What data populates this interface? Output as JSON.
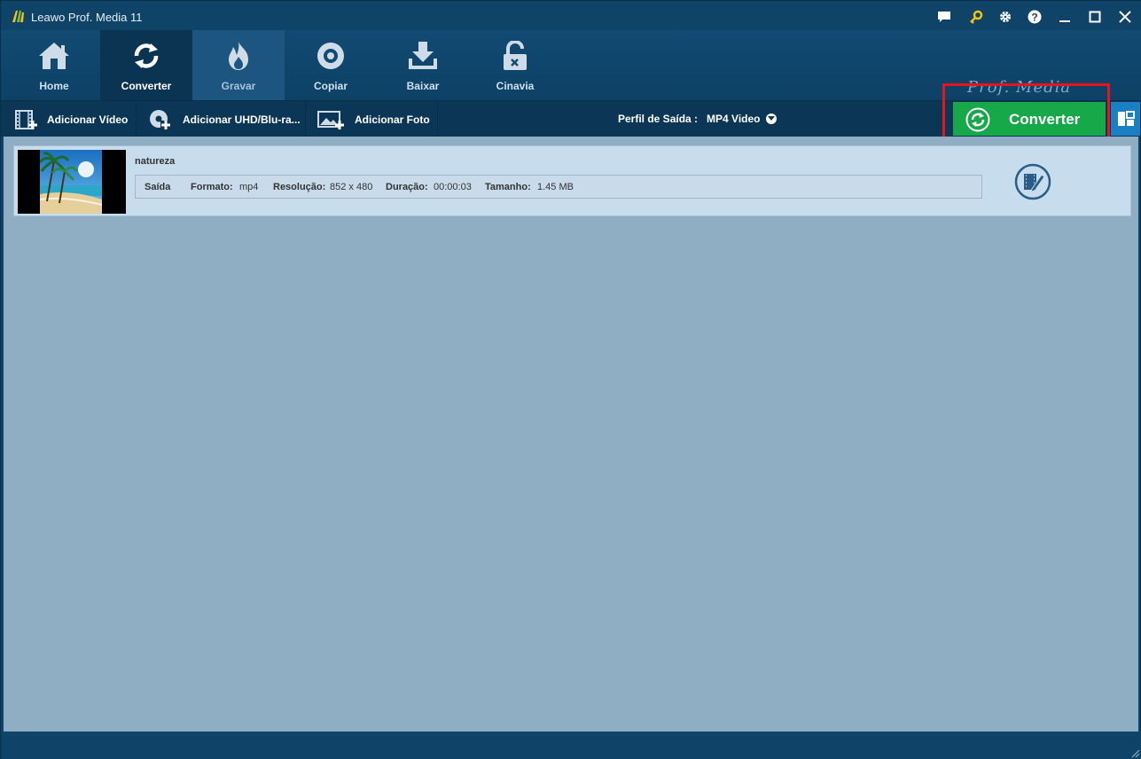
{
  "titlebar": {
    "title": "Leawo Prof. Media 11",
    "icons": [
      "chat-icon",
      "key-icon",
      "gear-icon",
      "help-icon",
      "minimize-icon",
      "maximize-icon",
      "close-icon"
    ]
  },
  "nav": {
    "items": [
      {
        "label": "Home",
        "icon": "home-icon"
      },
      {
        "label": "Converter",
        "icon": "convert-icon",
        "active": true
      },
      {
        "label": "Gravar",
        "icon": "fire-icon"
      },
      {
        "label": "Copiar",
        "icon": "disc-icon"
      },
      {
        "label": "Baixar",
        "icon": "download-icon"
      },
      {
        "label": "Cinavia",
        "icon": "unlock-icon"
      }
    ],
    "brand": "Prof. Media"
  },
  "toolbar": {
    "add_video": "Adicionar Vídeo",
    "add_uhd": "Adicionar UHD/Blu-ra...",
    "add_photo": "Adicionar Foto",
    "profile_label": "Perfil de Saída :",
    "profile_value": "MP4 Video",
    "convert_label": "Converter"
  },
  "file": {
    "name": "natureza",
    "output_label": "Saída",
    "format_label": "Formato:",
    "format_value": "mp4",
    "resolution_label": "Resolução:",
    "resolution_value": "852 x 480",
    "duration_label": "Duração:",
    "duration_value": "00:00:03",
    "size_label": "Tamanho:",
    "size_value": "1.45 MB"
  },
  "colors": {
    "header": "#0f4468",
    "content": "#8fadc3",
    "convert": "#17a84a",
    "highlight": "#e8141b"
  }
}
